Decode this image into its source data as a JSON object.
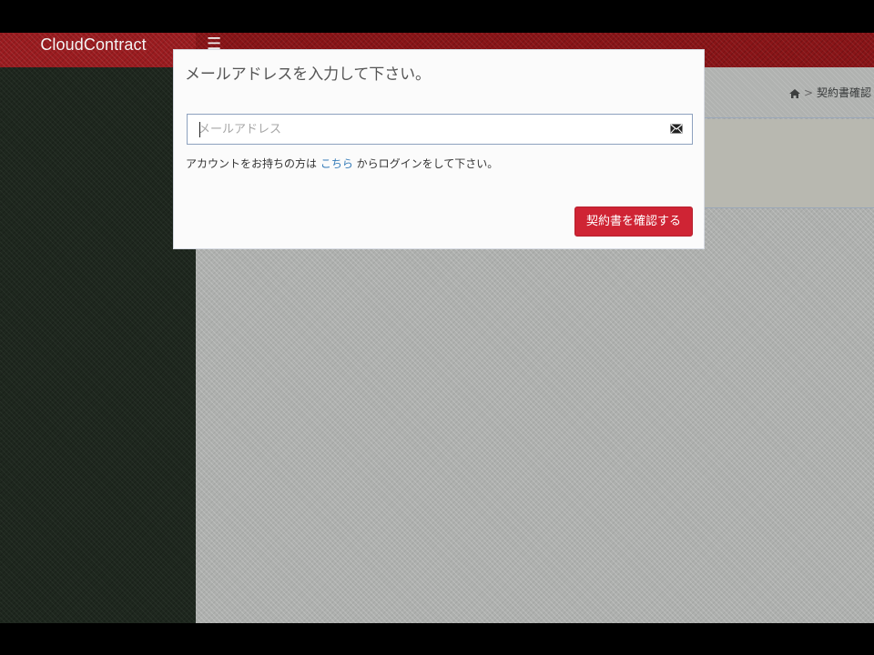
{
  "app": {
    "brand": "CloudContract"
  },
  "navigation": {
    "menu_icon": "hamburger-menu-icon"
  },
  "breadcrumb": {
    "home_icon": "home-icon",
    "separator": ">",
    "current": "契約書確認"
  },
  "modal": {
    "title": "メールアドレスを入力して下さい。",
    "email": {
      "value": "",
      "placeholder": "メールアドレス",
      "icon": "envelope-icon"
    },
    "help": {
      "prefix": "アカウントをお持ちの方は ",
      "link": "こちら",
      "suffix": " からログインをして下さい。"
    },
    "button": {
      "label": "契約書を確認する"
    }
  },
  "colors": {
    "brand_red": "#9a1b1f",
    "button_red": "#cf2434",
    "link_blue": "#337ab7"
  }
}
